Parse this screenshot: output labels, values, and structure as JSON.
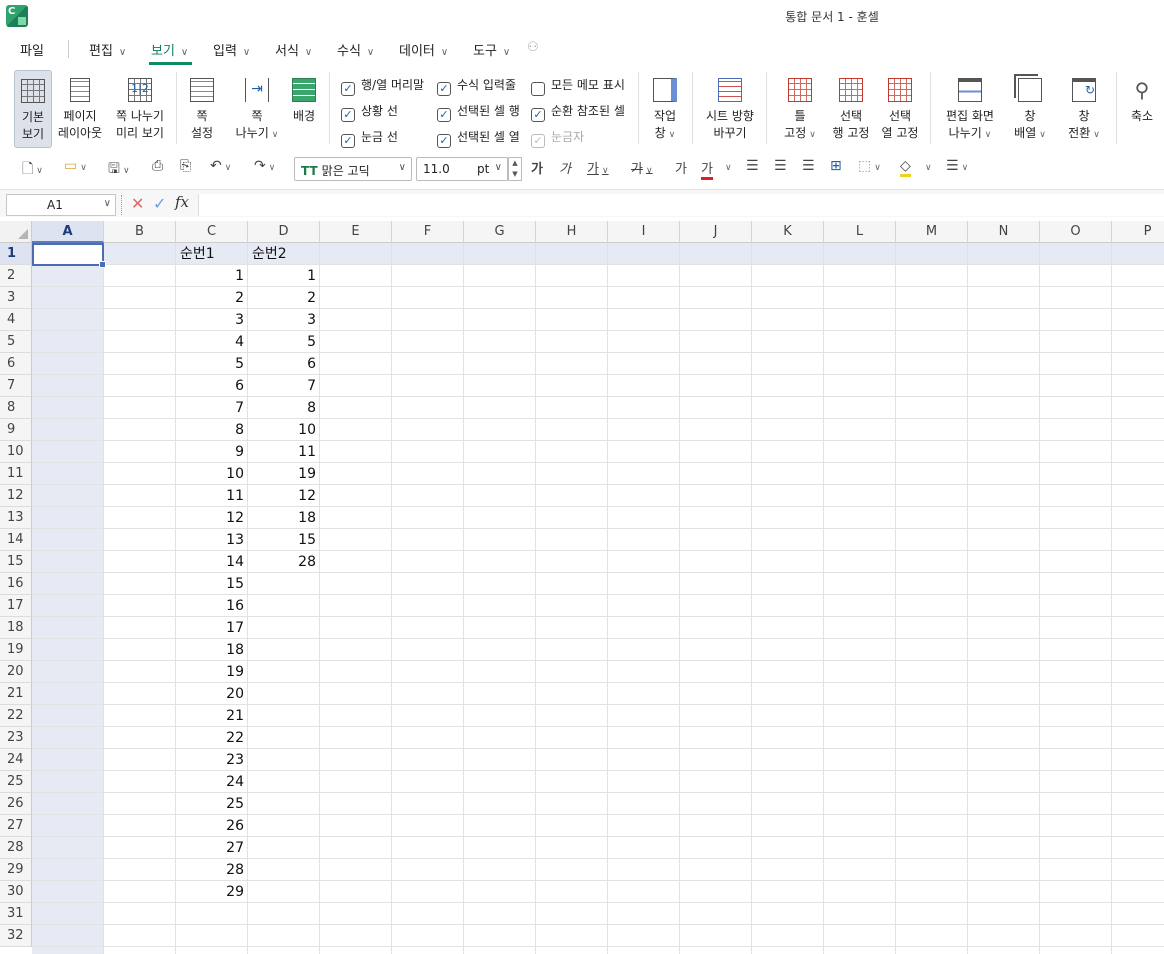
{
  "window": {
    "title": "통합 문서 1 - 훈셀",
    "logo_letter": "C"
  },
  "menu": {
    "file": "파일",
    "items": [
      {
        "label": "편집",
        "active": false
      },
      {
        "label": "보기",
        "active": true
      },
      {
        "label": "입력",
        "active": false
      },
      {
        "label": "서식",
        "active": false
      },
      {
        "label": "수식",
        "active": false
      },
      {
        "label": "데이터",
        "active": false
      },
      {
        "label": "도구",
        "active": false
      }
    ]
  },
  "ribbon": {
    "basic_view": [
      "기본",
      "보기"
    ],
    "page_layout": [
      "페이지",
      "레이아웃"
    ],
    "page_break_preview": [
      "쪽 나누기",
      "미리 보기"
    ],
    "page_setup": [
      "쪽",
      "설정"
    ],
    "page_break": [
      "쪽",
      "나누기"
    ],
    "background": "배경",
    "checks": [
      {
        "label": "행/열 머리말",
        "checked": true,
        "disabled": false
      },
      {
        "label": "수식 입력줄",
        "checked": true,
        "disabled": false
      },
      {
        "label": "모든 메모 표시",
        "checked": false,
        "disabled": false
      },
      {
        "label": "상황 선",
        "checked": true,
        "disabled": false
      },
      {
        "label": "선택된 셀 행",
        "checked": true,
        "disabled": false
      },
      {
        "label": "순환 참조된 셀",
        "checked": true,
        "disabled": false
      },
      {
        "label": "눈금 선",
        "checked": true,
        "disabled": false
      },
      {
        "label": "선택된 셀 열",
        "checked": true,
        "disabled": false
      },
      {
        "label": "눈금자",
        "checked": true,
        "disabled": true
      }
    ],
    "task_pane": [
      "작업",
      "창"
    ],
    "sheet_direction": [
      "시트 방향",
      "바꾸기"
    ],
    "freeze_panes": [
      "틀",
      "고정"
    ],
    "freeze_row": [
      "선택",
      "행 고정"
    ],
    "freeze_col": [
      "선택",
      "열 고정"
    ],
    "split_screen": [
      "편집 화면",
      "나누기"
    ],
    "arrange": [
      "창",
      "배열"
    ],
    "switch_window": [
      "창",
      "전환"
    ],
    "zoom": "축소"
  },
  "toolbar": {
    "font_name": "맑은 고딕",
    "font_size": "11.0",
    "font_unit": "pt",
    "bold_glyph": "가",
    "italic_glyph": "가",
    "underline_glyph": "가",
    "strike_glyph": "가",
    "shadow_glyph": "가",
    "color_glyph": "가"
  },
  "formula_bar": {
    "cell_ref": "A1",
    "formula": ""
  },
  "sheet": {
    "columns": [
      "A",
      "B",
      "C",
      "D",
      "E",
      "F",
      "G",
      "H",
      "I",
      "J",
      "K",
      "L",
      "M",
      "N",
      "O",
      "P"
    ],
    "selected_column": "A",
    "selected_row": 1,
    "rows": [
      "1",
      "2",
      "3",
      "4",
      "5",
      "6",
      "7",
      "8",
      "9",
      "10",
      "11",
      "12",
      "13",
      "14",
      "15",
      "16",
      "17",
      "18",
      "19",
      "20",
      "21",
      "22",
      "23",
      "24",
      "25",
      "26",
      "27",
      "28",
      "29",
      "30",
      "31",
      "32"
    ],
    "headers": {
      "C1": "순번1",
      "D1": "순번2"
    },
    "col_C": [
      "1",
      "2",
      "3",
      "4",
      "5",
      "6",
      "7",
      "8",
      "9",
      "10",
      "11",
      "12",
      "13",
      "14",
      "15",
      "16",
      "17",
      "18",
      "19",
      "20",
      "21",
      "22",
      "23",
      "24",
      "25",
      "26",
      "27",
      "28",
      "29"
    ],
    "col_D": [
      "1",
      "2",
      "3",
      "5",
      "6",
      "7",
      "8",
      "10",
      "11",
      "19",
      "12",
      "18",
      "15",
      "28"
    ]
  }
}
